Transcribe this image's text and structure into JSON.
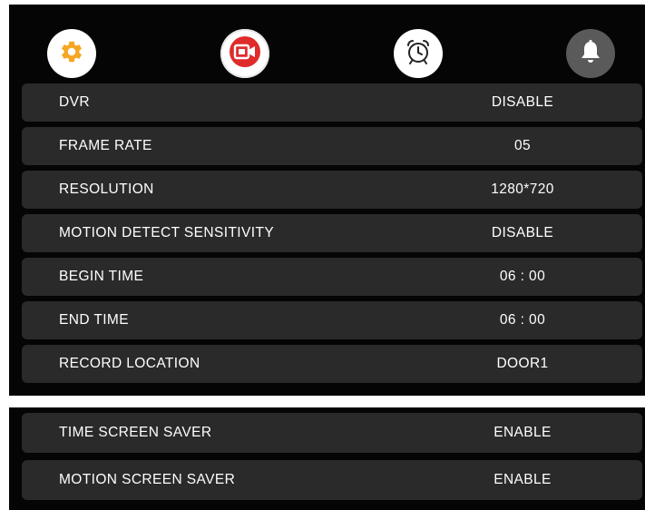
{
  "tabs": [
    {
      "name": "settings",
      "icon": "gear-icon",
      "color": "#f5a623",
      "active": false
    },
    {
      "name": "record",
      "icon": "video-camera-icon",
      "color": "#e02b2b",
      "active": true
    },
    {
      "name": "alarm",
      "icon": "alarm-clock-icon",
      "color": "#222222",
      "active": false
    },
    {
      "name": "bell",
      "icon": "bell-icon",
      "color": "#ffffff",
      "active": false
    }
  ],
  "settings": [
    {
      "label": "DVR",
      "value": "DISABLE"
    },
    {
      "label": "FRAME RATE",
      "value": "05"
    },
    {
      "label": "RESOLUTION",
      "value": "1280*720"
    },
    {
      "label": "MOTION DETECT SENSITIVITY",
      "value": "DISABLE"
    },
    {
      "label": "BEGIN TIME",
      "value": "06 : 00"
    },
    {
      "label": "END TIME",
      "value": "06 : 00"
    },
    {
      "label": "RECORD LOCATION",
      "value": "DOOR1"
    }
  ],
  "screen_saver": [
    {
      "label": "TIME SCREEN SAVER",
      "value": "ENABLE"
    },
    {
      "label": "MOTION SCREEN SAVER",
      "value": "ENABLE"
    }
  ],
  "colors": {
    "panel_bg": "#050505",
    "row_bg": "#2a2a2a",
    "text": "#ffffff",
    "accent_red": "#e02b2b",
    "accent_orange": "#f5a623"
  }
}
